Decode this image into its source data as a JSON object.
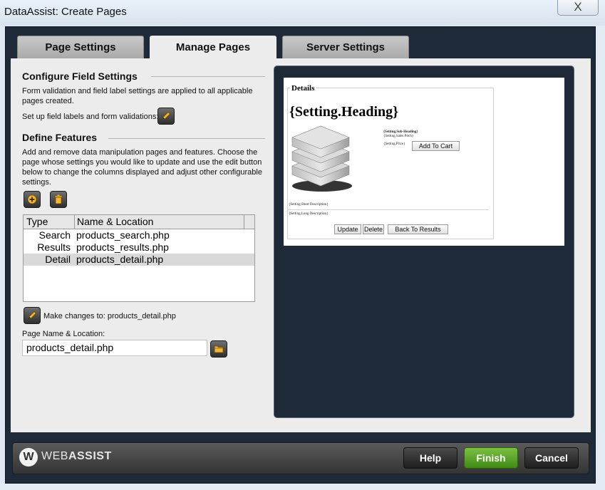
{
  "window": {
    "title": "DataAssist: Create Pages",
    "close_glyph": "X"
  },
  "tabs": [
    {
      "label": "Page Settings",
      "active": false
    },
    {
      "label": "Manage Pages",
      "active": true
    },
    {
      "label": "Server Settings",
      "active": false
    }
  ],
  "configure": {
    "heading": "Configure Field Settings",
    "description_line1": "Form validation and field label settings are applied to all applicable",
    "description_line2": "pages created.",
    "setup_label": "Set up field labels and form validations:"
  },
  "features": {
    "heading": "Define Features",
    "description_line1": "Add and remove data manipulation pages and features. Choose the",
    "description_line2": "page whose settings you would like to update and use the edit button",
    "description_line3": "below to change the columns displayed and adjust other configurable",
    "description_line4": "settings."
  },
  "pages_list": {
    "columns": [
      "Type",
      "Name & Location"
    ],
    "rows": [
      {
        "type": "Search",
        "name": "products_search.php",
        "selected": false
      },
      {
        "type": "Results",
        "name": "products_results.php",
        "selected": false
      },
      {
        "type": "Detail",
        "name": "products_detail.php",
        "selected": true
      }
    ]
  },
  "edit": {
    "label": "Make changes to: products_detail.php"
  },
  "page_name": {
    "label": "Page Name & Location:",
    "value": "products_detail.php"
  },
  "preview": {
    "legend": "Details",
    "heading": "{Setting.Heading}",
    "sub_heading": "{Setting.Sub-Heading}",
    "sales_pitch": "{Setting.Sales Pitch}",
    "price": "{Setting.Price}",
    "add_to_cart": "Add To Cart",
    "short_description": "{Setting.Short Description}",
    "long_description": "{Setting.Long Description}",
    "update_button": "Update",
    "delete_button": "Delete",
    "back_button": "Back To Results"
  },
  "footer": {
    "logo_mark": "W",
    "logo_text_light": "WEB",
    "logo_text_bold": "ASSIST",
    "help": "Help",
    "finish": "Finish",
    "cancel": "Cancel"
  },
  "colors": {
    "dark_panel": "#1f2a38",
    "finish_green": "#5aa52a",
    "content_bg": "#ececec"
  },
  "icons": [
    "pencil-icon",
    "plus-icon",
    "trash-icon",
    "folder-icon",
    "webassist-logo"
  ]
}
